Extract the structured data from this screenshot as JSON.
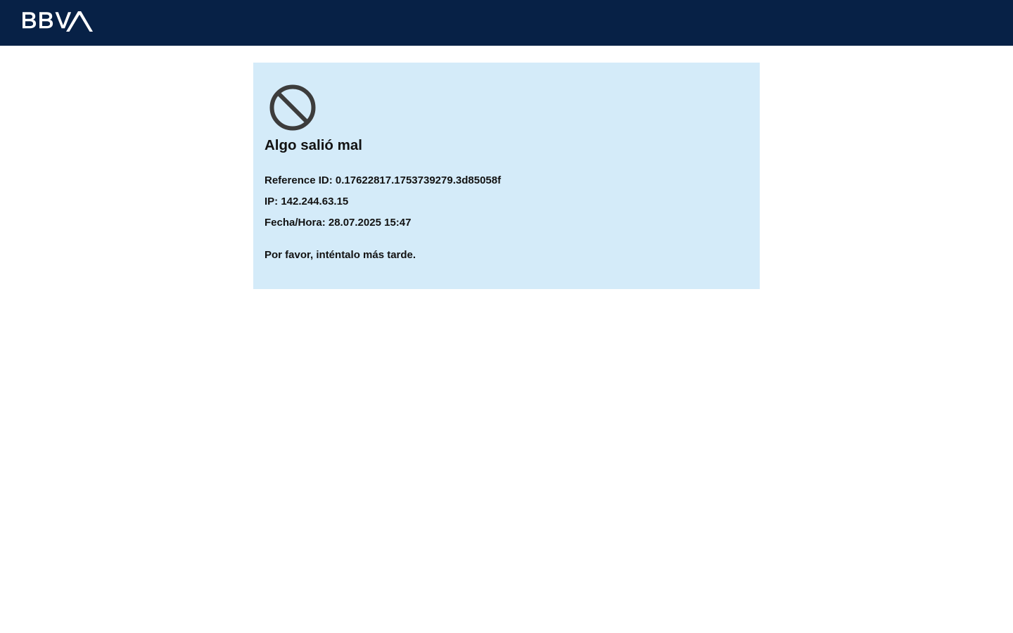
{
  "header": {
    "logo_text": "BBVA",
    "background_color": "#072146"
  },
  "error": {
    "icon": "ban-icon",
    "title": "Algo salió mal",
    "reference_id": "Reference ID: 0.17622817.1753739279.3d85058f",
    "ip": "IP: 142.244.63.15",
    "datetime": "Fecha/Hora: 28.07.2025 15:47",
    "retry_message": "Por favor, inténtalo más tarde.",
    "background_color": "#d4ebf9"
  }
}
